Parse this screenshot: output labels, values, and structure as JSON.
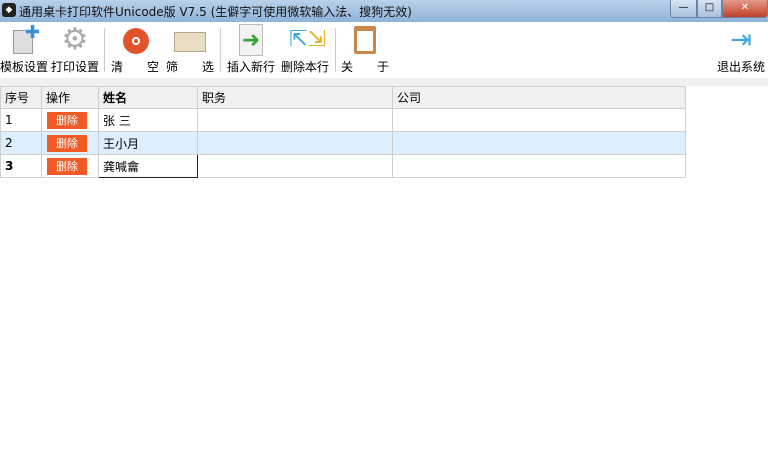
{
  "window": {
    "title": "通用桌卡打印软件Unicode版  V7.5  (生僻字可使用微软输入法、搜狗无效)",
    "minimize": "—",
    "maximize": "□",
    "close": "✕"
  },
  "toolbar": {
    "template": "模板设置",
    "print": "打印设置",
    "clear": "清　　空",
    "filter": "筛　　选",
    "insert": "插入新行",
    "delete_row": "删除本行",
    "about": "关　　于",
    "exit": "退出系统"
  },
  "table": {
    "headers": [
      "序号",
      "操作",
      "姓名",
      "职务",
      "公司"
    ],
    "rows": [
      {
        "no": "1",
        "action": "删除",
        "name": "张 三",
        "title": "",
        "company": ""
      },
      {
        "no": "2",
        "action": "删除",
        "name": "王小月",
        "title": "",
        "company": ""
      },
      {
        "no": "3",
        "action": "删除",
        "name": "龚喊龠",
        "title": "",
        "company": ""
      }
    ]
  }
}
